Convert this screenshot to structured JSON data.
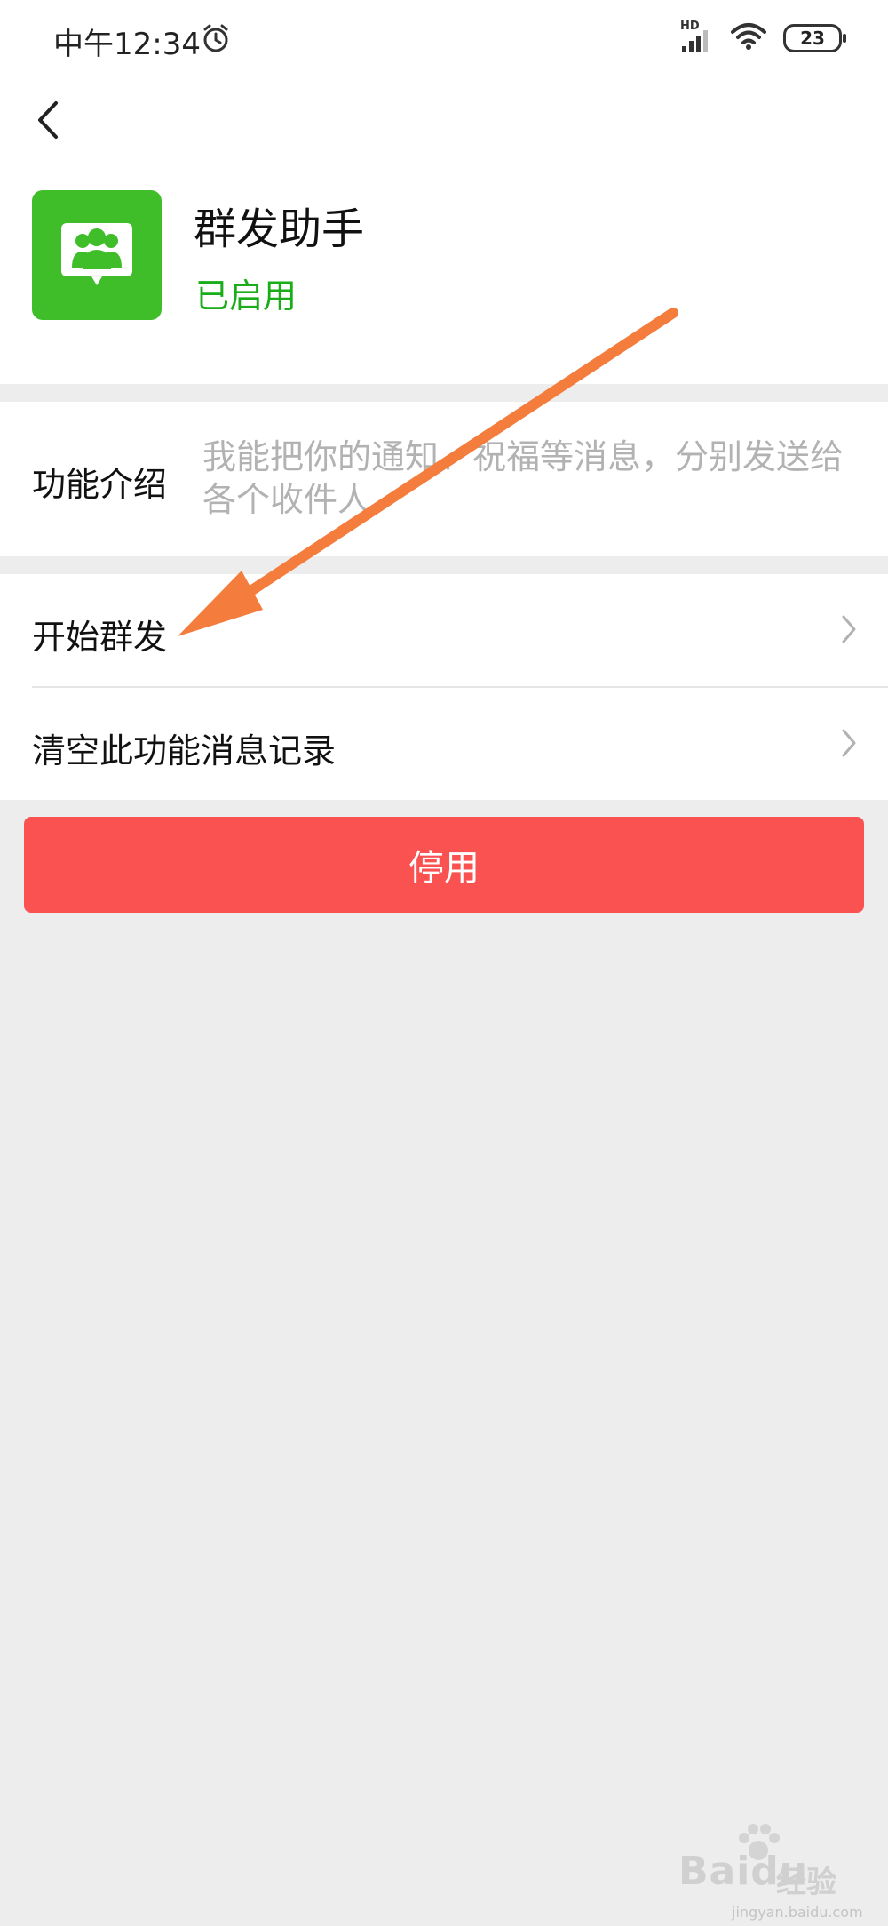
{
  "status_bar": {
    "time": "中午12:34",
    "hd": "HD",
    "battery": "23"
  },
  "header": {
    "title": "群发助手",
    "status": "已启用",
    "status_color": "#1aad19",
    "icon_bg": "#3fbe2a"
  },
  "intro": {
    "label": "功能介绍",
    "text": "我能把你的通知、祝福等消息，分别发送给各个收件人"
  },
  "menu": {
    "items": [
      {
        "label": "开始群发"
      },
      {
        "label": "清空此功能消息记录"
      }
    ]
  },
  "disable_button": {
    "label": "停用",
    "color": "#fa5151"
  },
  "annotation": {
    "arrow_color": "#f47c3c"
  },
  "watermark": {
    "brand": "Baidu",
    "sub": "经验",
    "url": "jingyan.baidu.com"
  }
}
